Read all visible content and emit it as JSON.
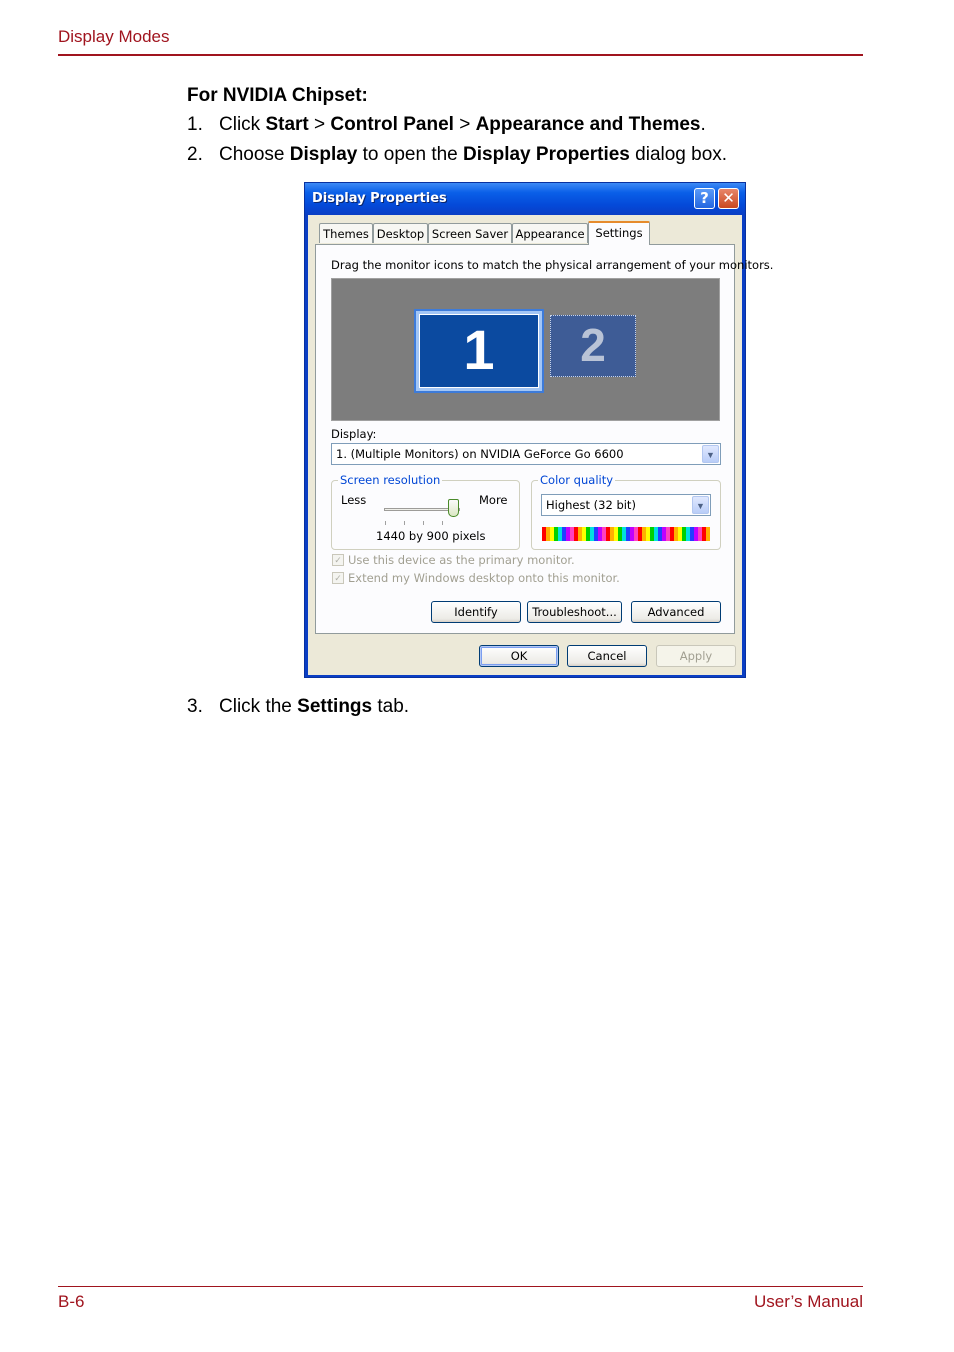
{
  "header": {
    "section": "Display Modes"
  },
  "footer": {
    "page": "B-6",
    "manual": "User’s Manual"
  },
  "content": {
    "section_title": "For NVIDIA Chipset:",
    "step1": {
      "num": "1.",
      "t1": "Click ",
      "b1": "Start",
      "t2": " > ",
      "b2": "Control Panel",
      "t3": " > ",
      "b3": "Appearance and Themes",
      "t4": "."
    },
    "step2": {
      "num": "2.",
      "t1": "Choose ",
      "b1": "Display",
      "t2": " to open the ",
      "b2": "Display Properties",
      "t3": " dialog box."
    },
    "step3": {
      "num": "3.",
      "t1": "Click the ",
      "b1": "Settings",
      "t2": " tab."
    }
  },
  "dialog": {
    "title": "Display Properties",
    "help_glyph": "?",
    "close_glyph": "✕",
    "tabs": [
      "Themes",
      "Desktop",
      "Screen Saver",
      "Appearance",
      "Settings"
    ],
    "active_tab": "Settings",
    "instruction": "Drag the monitor icons to match the physical arrangement of your monitors.",
    "monitors": [
      "1",
      "2"
    ],
    "display_label": "Display:",
    "display_value": "1. (Multiple Monitors) on NVIDIA GeForce Go 6600",
    "resolution": {
      "label": "Screen resolution",
      "less": "Less",
      "more": "More",
      "value": "1440 by 900 pixels"
    },
    "color_quality": {
      "label": "Color quality",
      "value": "Highest (32 bit)"
    },
    "checkbox_primary": "Use this device as the primary monitor.",
    "checkbox_extend": "Extend my Windows desktop onto this monitor.",
    "buttons": {
      "identify": "Identify",
      "troubleshoot": "Troubleshoot...",
      "advanced": "Advanced",
      "ok": "OK",
      "cancel": "Cancel",
      "apply": "Apply"
    },
    "colors": {
      "title_bar": "#0a5fe8",
      "active_tab_accent": "#e68b2c",
      "group_label": "#0046d5"
    }
  }
}
